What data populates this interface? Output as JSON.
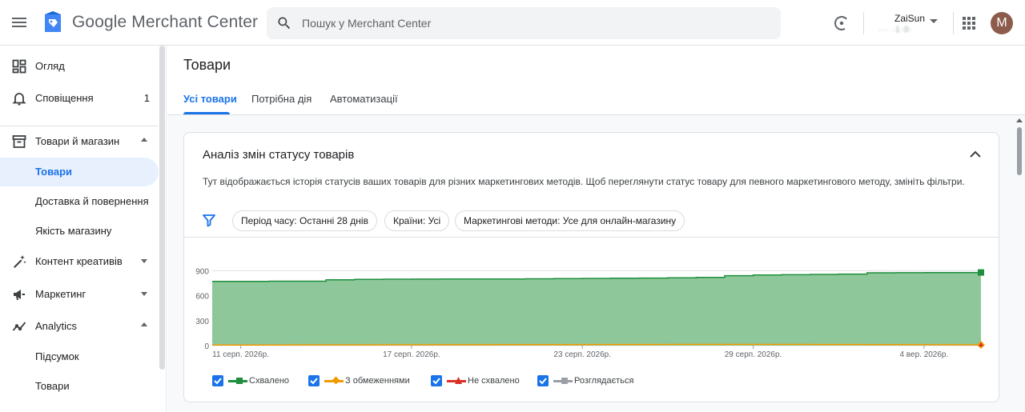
{
  "header": {
    "product_name": "Google Merchant Center",
    "search_placeholder": "Пошук у Merchant Center",
    "account_name": "ZaiSun",
    "account_id": "··· ·1·0·",
    "avatar_letter": "M"
  },
  "sidebar": {
    "items": [
      {
        "label": "Огляд",
        "icon": "dashboard-icon"
      },
      {
        "label": "Сповіщення",
        "icon": "bell-icon",
        "badge": "1"
      },
      {
        "label": "Товари й магазин",
        "icon": "store-icon",
        "expanded": true
      },
      {
        "label": "Товари",
        "active": true
      },
      {
        "label": "Доставка й повернення"
      },
      {
        "label": "Якість магазину"
      },
      {
        "label": "Контент креативів",
        "icon": "magic-wand-icon",
        "expanded": false
      },
      {
        "label": "Маркетинг",
        "icon": "megaphone-icon",
        "expanded": false
      },
      {
        "label": "Analytics",
        "icon": "analytics-icon",
        "expanded": true
      },
      {
        "label": "Підсумок"
      },
      {
        "label": "Товари"
      }
    ]
  },
  "main": {
    "page_title": "Товари",
    "tabs": [
      {
        "label": "Усі товари",
        "active": true
      },
      {
        "label": "Потрібна дія"
      },
      {
        "label": "Автоматизації"
      }
    ],
    "card": {
      "title": "Аналіз змін статусу товарів",
      "description": "Тут відображається історія статусів ваших товарів для різних маркетингових методів. Щоб переглянути статус товару для певного маркетингового методу, змініть фільтри.",
      "filters": [
        "Період часу: Останні 28 днів",
        "Країни: Усі",
        "Маркетингові методи: Усе для онлайн-магазину"
      ]
    }
  },
  "colors": {
    "accent": "#1a73e8",
    "approved": "#1e8e3e",
    "approved_fill": "#8ec89a",
    "limited": "#f29900",
    "disapproved": "#d93025",
    "pending": "#9aa0a6"
  },
  "chart_data": {
    "type": "area",
    "x": [
      "10 серп.",
      "11 серп.",
      "12 серп.",
      "13 серп.",
      "14 серп.",
      "15 серп.",
      "16 серп.",
      "17 серп.",
      "18 серп.",
      "19 серп.",
      "20 серп.",
      "21 серп.",
      "22 серп.",
      "23 серп.",
      "24 серп.",
      "25 серп.",
      "26 серп.",
      "27 серп.",
      "28 серп.",
      "29 серп.",
      "30 серп.",
      "31 серп.",
      "1 вер.",
      "2 вер.",
      "3 вер.",
      "4 вер.",
      "5 вер.",
      "6 вер."
    ],
    "x_tick_labels": [
      "11 серп. 2026р.",
      "17 серп. 2026р.",
      "23 серп. 2026р.",
      "29 серп. 2026р.",
      "4 вер. 2026р."
    ],
    "x_tick_index": [
      1,
      7,
      13,
      19,
      25
    ],
    "y_ticks": [
      "0",
      "300",
      "600",
      "900"
    ],
    "ylim": [
      0,
      1000
    ],
    "series": [
      {
        "name": "Схвалено",
        "values": [
          772,
          772,
          774,
          774,
          790,
          796,
          798,
          799,
          800,
          800,
          800,
          803,
          806,
          808,
          810,
          812,
          815,
          820,
          840,
          848,
          852,
          856,
          860,
          875,
          876,
          877,
          878,
          879
        ]
      },
      {
        "name": "З обмеженнями",
        "values": [
          8,
          8,
          8,
          9,
          9,
          9,
          10,
          10,
          11,
          11,
          12,
          12,
          12,
          13,
          13,
          13,
          14,
          14,
          14,
          14,
          14,
          13,
          13,
          12,
          12,
          11,
          10,
          9
        ]
      },
      {
        "name": "Не схвалено",
        "values": [
          0,
          0,
          0,
          0,
          0,
          0,
          0,
          0,
          0,
          0,
          0,
          0,
          0,
          0,
          0,
          0,
          0,
          0,
          0,
          0,
          0,
          0,
          0,
          0,
          0,
          0,
          0,
          0
        ]
      },
      {
        "name": "Розглядається",
        "values": [
          0,
          0,
          0,
          0,
          0,
          0,
          0,
          0,
          0,
          0,
          0,
          0,
          0,
          0,
          0,
          0,
          0,
          0,
          0,
          0,
          0,
          0,
          0,
          0,
          0,
          0,
          0,
          0
        ]
      }
    ],
    "grid": true
  }
}
